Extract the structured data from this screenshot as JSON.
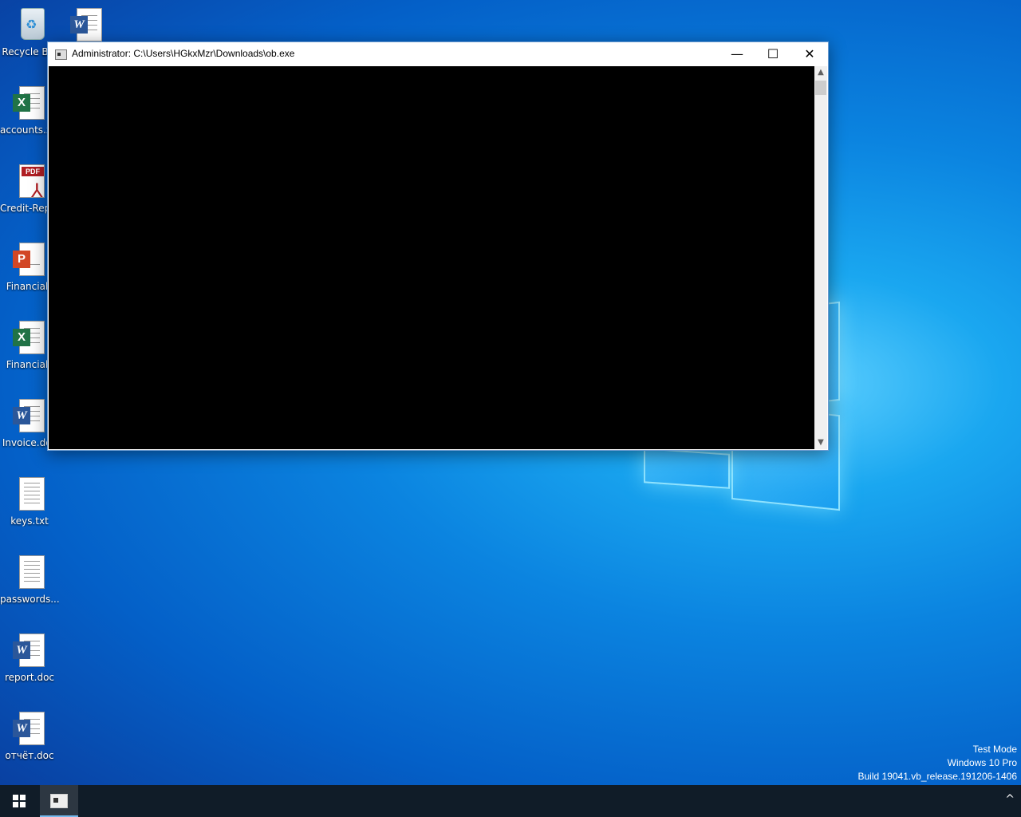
{
  "desktop": {
    "icons": [
      {
        "label": "Recycle Bin",
        "type": "recycle"
      },
      {
        "label": "accounts.xlsx",
        "type": "excel"
      },
      {
        "label": "Credit-Report.pdf",
        "type": "pdf"
      },
      {
        "label": "Financial_",
        "type": "powerpoint"
      },
      {
        "label": "Financial_",
        "type": "excel"
      },
      {
        "label": "Invoice.doc",
        "type": "word"
      },
      {
        "label": "keys.txt",
        "type": "text"
      },
      {
        "label": "passwords....",
        "type": "text"
      },
      {
        "label": "report.doc",
        "type": "word"
      },
      {
        "label": "отчёт.doc",
        "type": "word"
      }
    ],
    "top_icon_type": "word"
  },
  "window": {
    "title": "Administrator: C:\\Users\\HGkxMzr\\Downloads\\ob.exe",
    "minimize_glyph": "—",
    "maximize_glyph": "☐",
    "close_glyph": "✕",
    "scroll_up": "▲",
    "scroll_down": "▼"
  },
  "watermark": {
    "line1": "Test Mode",
    "line2": "Windows 10 Pro",
    "line3": "Build 19041.vb_release.191206-1406"
  },
  "taskbar": {
    "tray_chevron": "^"
  },
  "colors": {
    "accent": "#0078d7",
    "taskbar": "#101c28"
  }
}
